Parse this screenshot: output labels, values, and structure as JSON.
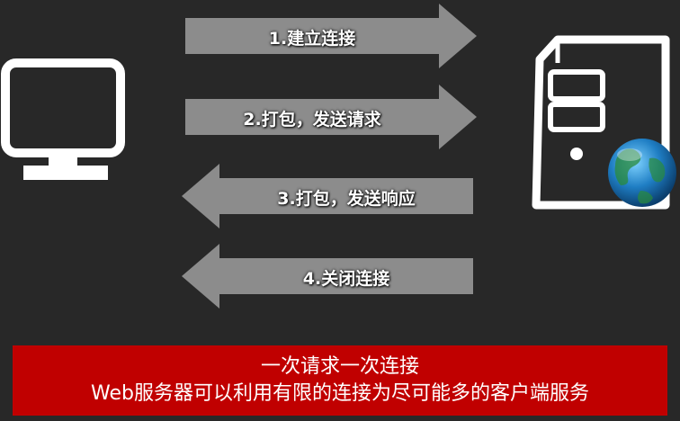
{
  "arrows": [
    {
      "label": "1.建立连接",
      "direction": "right"
    },
    {
      "label": "2.打包，发送请求",
      "direction": "right"
    },
    {
      "label": "3.打包，发送响应",
      "direction": "left"
    },
    {
      "label": "4.关闭连接",
      "direction": "left"
    }
  ],
  "icons": {
    "client": "monitor-icon",
    "server": "server-tower-icon",
    "globe": "globe-icon"
  },
  "banner": {
    "line1": "一次请求一次连接",
    "line2": "Web服务器可以利用有限的连接为尽可能多的客户端服务"
  },
  "colors": {
    "background": "#282828",
    "arrow": "#8c8c8c",
    "banner": "#c00000",
    "icon_stroke": "#ffffff"
  }
}
